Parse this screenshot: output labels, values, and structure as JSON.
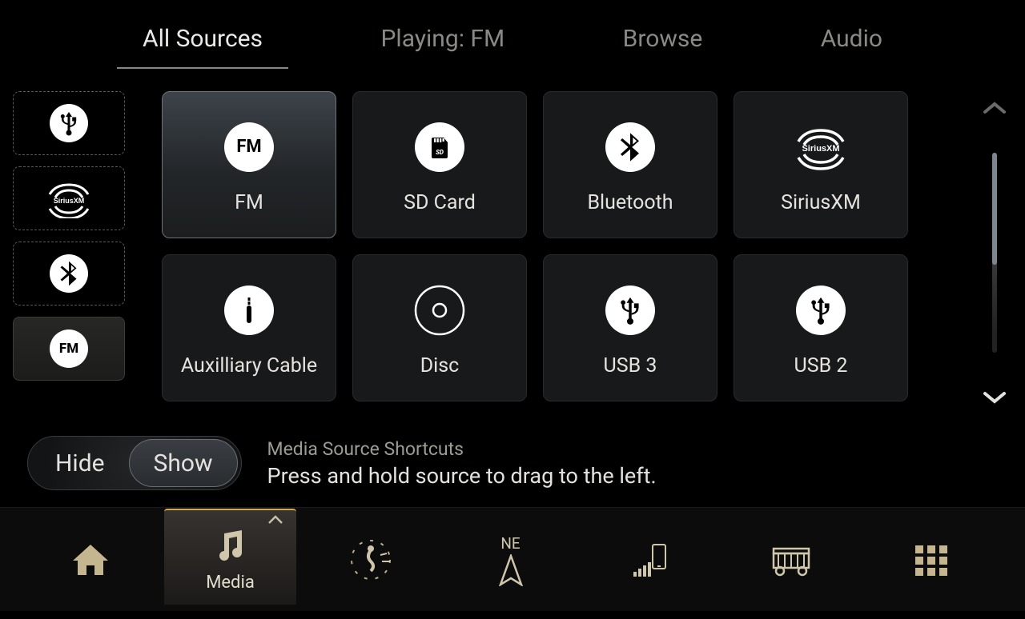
{
  "tabs": {
    "all": "All Sources",
    "playing": "Playing: FM",
    "browse": "Browse",
    "audio": "Audio"
  },
  "shortcuts": {
    "usb": {
      "icon": "usb-icon"
    },
    "sxm": {
      "icon": "siriusxm-logo"
    },
    "bt": {
      "icon": "bluetooth-icon"
    },
    "fm": {
      "label": "FM"
    }
  },
  "sources": {
    "fm": {
      "label": "FM"
    },
    "sd": {
      "label": "SD Card"
    },
    "bt": {
      "label": "Bluetooth"
    },
    "sxm": {
      "label": "SiriusXM"
    },
    "aux": {
      "label": "Auxilliary Cable"
    },
    "disc": {
      "label": "Disc"
    },
    "usb3": {
      "label": "USB 3"
    },
    "usb2": {
      "label": "USB 2"
    }
  },
  "panel": {
    "hide": "Hide",
    "show": "Show",
    "title": "Media Source Shortcuts",
    "subtitle": "Press and hold source to drag to the left."
  },
  "appbar": {
    "media": "Media",
    "nav_heading": "NE"
  }
}
